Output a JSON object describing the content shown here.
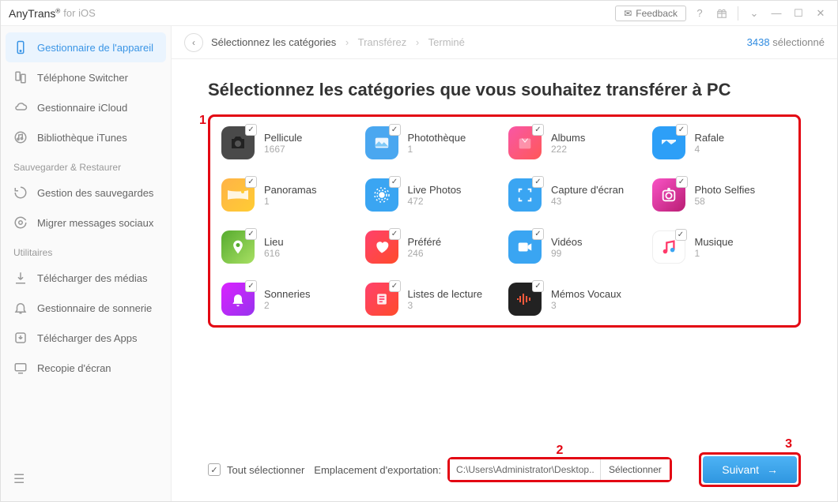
{
  "brand": {
    "name": "AnyTrans",
    "sub": "for iOS"
  },
  "titlebar": {
    "feedback": "Feedback"
  },
  "sidebar": {
    "items_a": [
      {
        "label": "Gestionnaire de l'appareil",
        "name": "device-manager"
      },
      {
        "label": "Téléphone Switcher",
        "name": "phone-switcher"
      },
      {
        "label": "Gestionnaire iCloud",
        "name": "icloud-manager"
      },
      {
        "label": "Bibliothèque iTunes",
        "name": "itunes-library"
      }
    ],
    "section_b": "Sauvegarder & Restaurer",
    "items_b": [
      {
        "label": "Gestion des sauvegardes",
        "name": "backup-manager"
      },
      {
        "label": "Migrer messages sociaux",
        "name": "migrate-social"
      }
    ],
    "section_c": "Utilitaires",
    "items_c": [
      {
        "label": "Télécharger des médias",
        "name": "download-media"
      },
      {
        "label": "Gestionnaire de sonnerie",
        "name": "ringtone-manager"
      },
      {
        "label": "Télécharger des Apps",
        "name": "download-apps"
      },
      {
        "label": "Recopie d'écran",
        "name": "screen-mirror"
      }
    ]
  },
  "breadcrumb": {
    "a": "Sélectionnez les catégories",
    "b": "Transférez",
    "c": "Terminé"
  },
  "selection": {
    "count": "3438",
    "label": "sélectionné"
  },
  "heading": "Sélectionnez les catégories que vous souhaitez transférer à PC",
  "annotations": {
    "n1": "1",
    "n2": "2",
    "n3": "3"
  },
  "categories": [
    {
      "label": "Pellicule",
      "count": "1667",
      "bg": "#4a4a4a",
      "icon": "camera"
    },
    {
      "label": "Photothèque",
      "count": "1",
      "bg": "#4aa7f0",
      "icon": "photo"
    },
    {
      "label": "Albums",
      "count": "222",
      "bg": "linear-gradient(135deg,#f857a6,#ff5858)",
      "icon": "album"
    },
    {
      "label": "Rafale",
      "count": "4",
      "bg": "#2d9ff7",
      "icon": "burst"
    },
    {
      "label": "Panoramas",
      "count": "1",
      "bg": "linear-gradient(135deg,#ffb347,#ffcc33)",
      "icon": "pano"
    },
    {
      "label": "Live Photos",
      "count": "472",
      "bg": "#3aa5f2",
      "icon": "live"
    },
    {
      "label": "Capture d'écran",
      "count": "43",
      "bg": "#3aa5f2",
      "icon": "screenshot"
    },
    {
      "label": "Photo Selfies",
      "count": "58",
      "bg": "linear-gradient(135deg,#f953c6,#b91d73)",
      "icon": "selfie"
    },
    {
      "label": "Lieu",
      "count": "616",
      "bg": "linear-gradient(135deg,#56ab2f,#a8e063)",
      "icon": "pin"
    },
    {
      "label": "Préféré",
      "count": "246",
      "bg": "linear-gradient(135deg,#ff416c,#ff4b2b)",
      "icon": "heart"
    },
    {
      "label": "Vidéos",
      "count": "99",
      "bg": "#3aa5f2",
      "icon": "video"
    },
    {
      "label": "Musique",
      "count": "1",
      "bg": "#ffffff",
      "icon": "music"
    },
    {
      "label": "Sonneries",
      "count": "2",
      "bg": "linear-gradient(135deg,#da22ff,#9733ee)",
      "icon": "bell"
    },
    {
      "label": "Listes de lecture",
      "count": "3",
      "bg": "linear-gradient(135deg,#ff416c,#ff4b2b)",
      "icon": "list"
    },
    {
      "label": "Mémos Vocaux",
      "count": "3",
      "bg": "#222",
      "icon": "voice"
    }
  ],
  "footer": {
    "selectall": "Tout sélectionner",
    "exportlabel": "Emplacement d'exportation:",
    "path": "C:\\Users\\Administrator\\Desktop...",
    "browse": "Sélectionner",
    "next": "Suivant"
  }
}
